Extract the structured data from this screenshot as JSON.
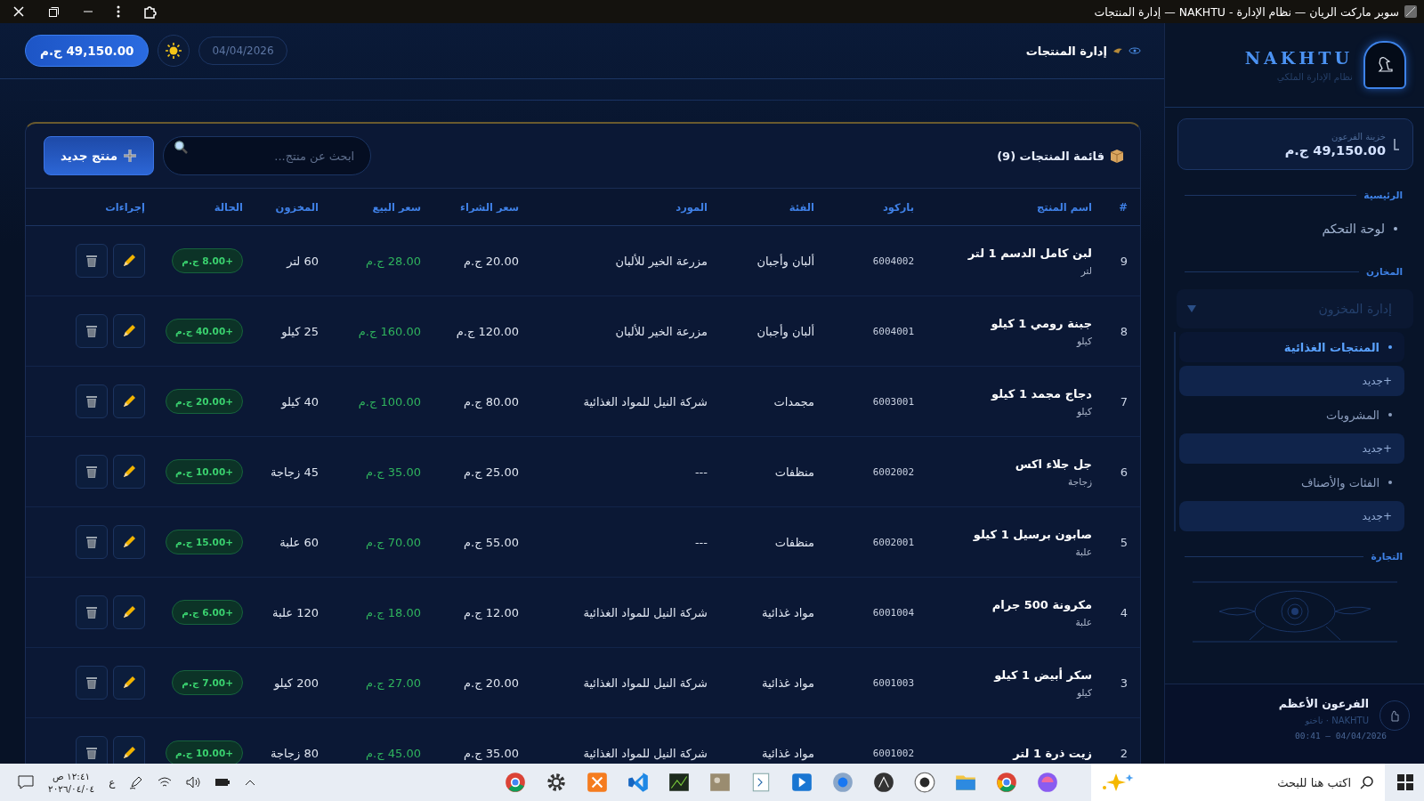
{
  "browser": {
    "title": "سوبر ماركت الريان — نظام الإدارة - NAKHTU — إدارة المنتجات"
  },
  "header": {
    "title": "إدارة المنتجات",
    "date": "04/04/2026",
    "balance": "49,150.00 ج.م"
  },
  "sidebar": {
    "logo": "NAKHTU",
    "subtitle": "نظام الإدارة الملكي",
    "treasury": {
      "label": "خزينة الفرعون",
      "amount": "49,150.00 ج.م"
    },
    "sections": [
      {
        "title": "الرئيسية",
        "items": [
          {
            "kind": "link",
            "label": "لوحة التحكم",
            "selected": false
          }
        ]
      },
      {
        "title": "المخازن",
        "items": [
          {
            "kind": "group",
            "label": "إدارة المخزون",
            "expanded": true,
            "children": [
              {
                "kind": "link",
                "label": "المنتجات الغذائية",
                "selected": true
              },
              {
                "kind": "add",
                "label": "+جديد"
              },
              {
                "kind": "link",
                "label": "المشروبات",
                "selected": false
              },
              {
                "kind": "add",
                "label": "+جديد"
              },
              {
                "kind": "link",
                "label": "الفئات والأصناف",
                "selected": false
              },
              {
                "kind": "add",
                "label": "+جديد"
              }
            ]
          }
        ]
      },
      {
        "title": "التجارة"
      }
    ],
    "user": {
      "name": "الفرعون الأعظم",
      "role": "NAKHTU · ناختو",
      "timestamp": "04/04/2026 — 00:41"
    }
  },
  "products": {
    "title": "قائمة المنتجات (9)",
    "search": {
      "placeholder": "ابحث عن منتج..."
    },
    "add_button": "منتج جديد",
    "columns": [
      "#",
      "اسم المنتج",
      "باركود",
      "الفئة",
      "المورد",
      "سعر الشراء",
      "سعر البيع",
      "المخزون",
      "الحالة",
      "إجراءات"
    ],
    "rows": [
      {
        "index": "9",
        "name": "لبن كامل الدسم 1 لتر",
        "unit": "لتر",
        "barcode": "6004002",
        "category": "ألبان وأجبان",
        "supplier": "مزرعة الخير للألبان",
        "purchase_price": "20.00 ج.م",
        "sale_price": "28.00 ج.م",
        "stock": "60 لتر",
        "margin": "+8.00 ج.م"
      },
      {
        "index": "8",
        "name": "جبنة رومي 1 كيلو",
        "unit": "كيلو",
        "barcode": "6004001",
        "category": "ألبان وأجبان",
        "supplier": "مزرعة الخير للألبان",
        "purchase_price": "120.00 ج.م",
        "sale_price": "160.00 ج.م",
        "stock": "25 كيلو",
        "margin": "+40.00 ج.م"
      },
      {
        "index": "7",
        "name": "دجاج مجمد 1 كيلو",
        "unit": "كيلو",
        "barcode": "6003001",
        "category": "مجمدات",
        "supplier": "شركة النيل للمواد الغذائية",
        "purchase_price": "80.00 ج.م",
        "sale_price": "100.00 ج.م",
        "stock": "40 كيلو",
        "margin": "+20.00 ج.م"
      },
      {
        "index": "6",
        "name": "جل جلاء اكس",
        "unit": "زجاجة",
        "barcode": "6002002",
        "category": "منظفات",
        "supplier": "---",
        "purchase_price": "25.00 ج.م",
        "sale_price": "35.00 ج.م",
        "stock": "45 زجاجة",
        "margin": "+10.00 ج.م"
      },
      {
        "index": "5",
        "name": "صابون برسيل 1 كيلو",
        "unit": "علبة",
        "barcode": "6002001",
        "category": "منظفات",
        "supplier": "---",
        "purchase_price": "55.00 ج.م",
        "sale_price": "70.00 ج.م",
        "stock": "60 علبة",
        "margin": "+15.00 ج.م"
      },
      {
        "index": "4",
        "name": "مكرونة 500 جرام",
        "unit": "علبة",
        "barcode": "6001004",
        "category": "مواد غذائية",
        "supplier": "شركة النيل للمواد الغذائية",
        "purchase_price": "12.00 ج.م",
        "sale_price": "18.00 ج.م",
        "stock": "120 علبة",
        "margin": "+6.00 ج.م"
      },
      {
        "index": "3",
        "name": "سكر أبيض 1 كيلو",
        "unit": "كيلو",
        "barcode": "6001003",
        "category": "مواد غذائية",
        "supplier": "شركة النيل للمواد الغذائية",
        "purchase_price": "20.00 ج.م",
        "sale_price": "27.00 ج.م",
        "stock": "200 كيلو",
        "margin": "+7.00 ج.م"
      },
      {
        "index": "2",
        "name": "زيت ذرة 1 لتر",
        "barcode": "6001002",
        "category": "مواد غذائية",
        "supplier": "شركة النيل للمواد الغذائية",
        "purchase_price": "35.00 ج.م",
        "sale_price": "45.00 ج.م",
        "stock": "80 زجاجة",
        "margin": "+10.00 ج.م"
      }
    ]
  },
  "taskbar": {
    "search": {
      "placeholder": "اكتب هنا للبحث"
    },
    "language": "ع",
    "time": "١٢:٤١ ص",
    "date": "٢٠٢٦/٠٤/٠٤"
  }
}
